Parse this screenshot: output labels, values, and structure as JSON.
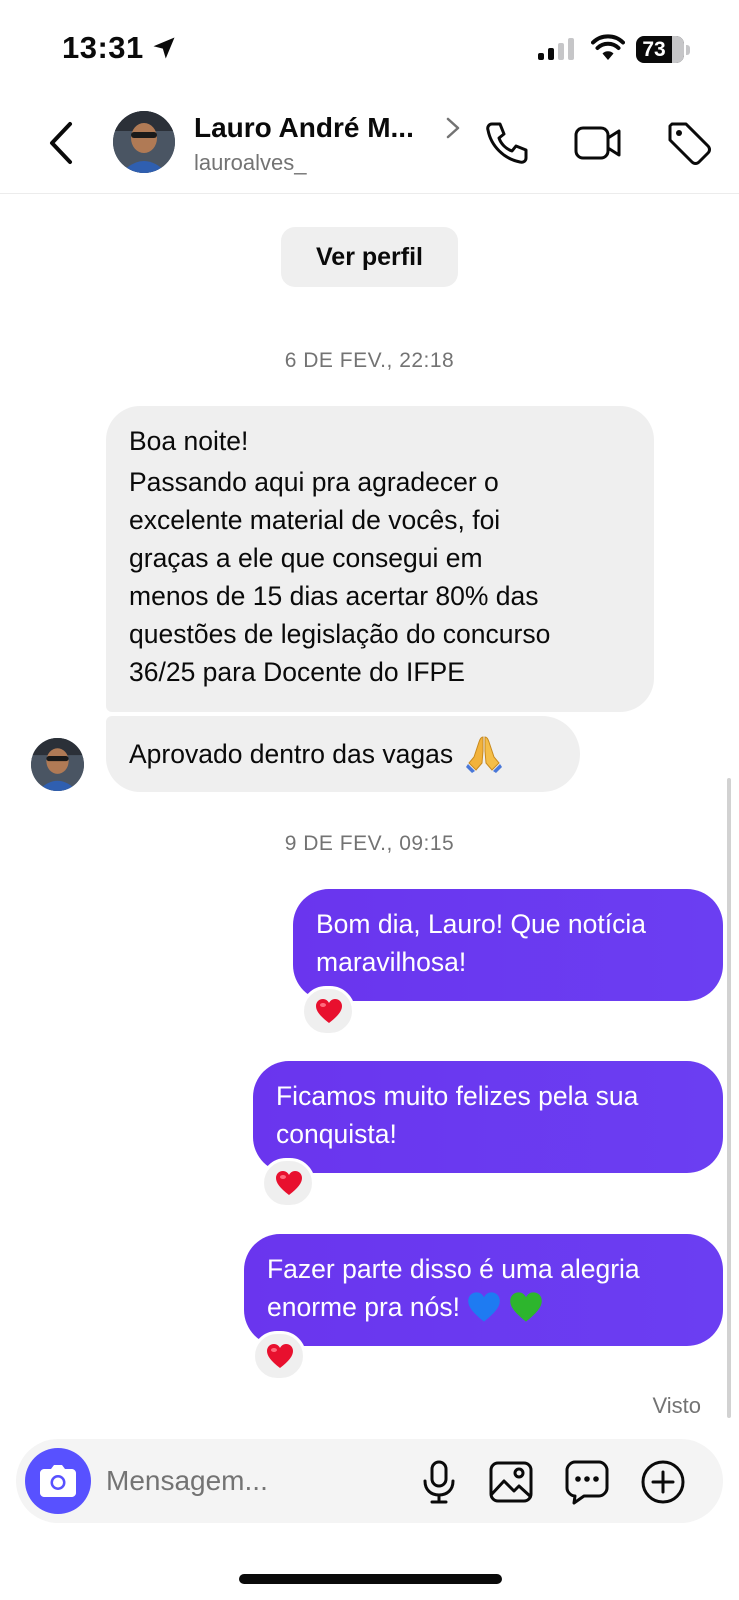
{
  "status_bar": {
    "time": "13:31",
    "battery_level": "73",
    "icons": [
      "location-arrow-icon",
      "cellular-signal-icon",
      "wifi-icon",
      "battery-icon"
    ]
  },
  "header": {
    "contact_name": "Lauro André M...",
    "username": "lauroalves_",
    "icons": [
      "back-chevron-icon",
      "chevron-right-icon",
      "phone-call-icon",
      "video-call-icon",
      "tag-icon"
    ]
  },
  "chat": {
    "profile_button": "Ver perfil",
    "timestamps": [
      "6 DE FEV., 22:18",
      "9 DE FEV., 09:15"
    ],
    "incoming": [
      {
        "lines": [
          "Boa noite!",
          "Passando aqui pra agradecer o",
          "excelente material de vocês, foi",
          "graças a ele que consegui em",
          "menos de 15 dias acertar 80% das",
          "questões de legislação do concurso",
          "36/25 para Docente do IFPE"
        ]
      },
      {
        "text": "Aprovado dentro das vagas",
        "emoji": "🙏"
      }
    ],
    "outgoing": [
      {
        "lines": [
          "Bom dia, Lauro! Que notícia",
          "maravilhosa!"
        ],
        "reaction": "❤️"
      },
      {
        "lines": [
          "Ficamos muito felizes pela sua",
          "conquista!"
        ],
        "reaction": "❤️"
      },
      {
        "lines": [
          "Fazer parte disso é uma alegria",
          "enorme pra nós!"
        ],
        "emoji_trailing": [
          "💙",
          "💚"
        ],
        "reaction": "❤️"
      }
    ],
    "seen_label": "Visto"
  },
  "composer": {
    "placeholder": "Mensagem...",
    "icons": [
      "camera-icon",
      "microphone-icon",
      "gallery-icon",
      "sticker-icon",
      "add-icon"
    ]
  },
  "colors": {
    "outgoing_bubble": "#6b3af0",
    "incoming_bubble": "#efefef",
    "camera_button": "#5851ff",
    "heart": "#e8102e",
    "blue_heart": "#1e7bf2",
    "green_heart": "#2db52d"
  }
}
